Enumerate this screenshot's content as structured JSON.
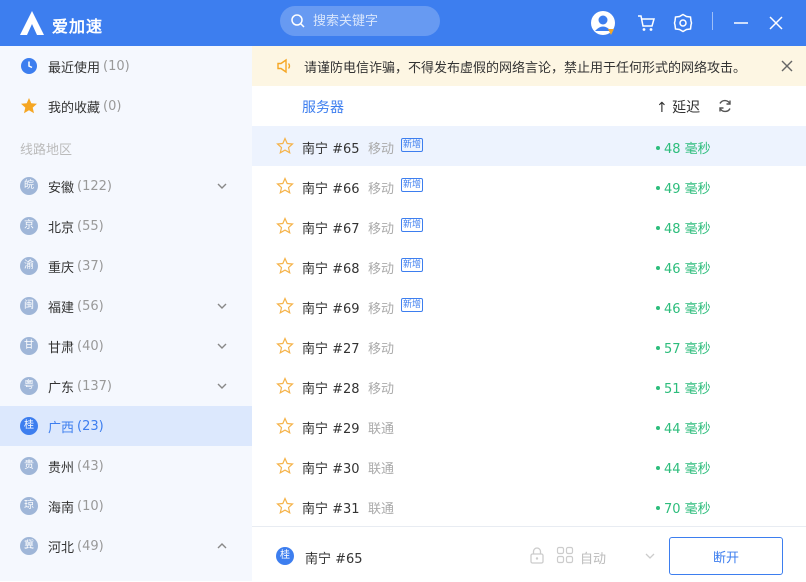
{
  "app": {
    "title": "爱加速",
    "search_placeholder": "搜索关键字"
  },
  "sidebar": {
    "top_items": [
      {
        "label": "最近使用",
        "count": "(10)"
      },
      {
        "label": "我的收藏",
        "count": "(0)"
      }
    ],
    "section_title": "线路地区",
    "regions": [
      {
        "badge": "皖",
        "label": "安徽",
        "count": "(122)"
      },
      {
        "badge": "京",
        "label": "北京",
        "count": "(55)"
      },
      {
        "badge": "渝",
        "label": "重庆",
        "count": "(37)"
      },
      {
        "badge": "闽",
        "label": "福建",
        "count": "(56)"
      },
      {
        "badge": "甘",
        "label": "甘肃",
        "count": "(40)"
      },
      {
        "badge": "粤",
        "label": "广东",
        "count": "(137)"
      },
      {
        "badge": "桂",
        "label": "广西",
        "count": "(23)"
      },
      {
        "badge": "贵",
        "label": "贵州",
        "count": "(43)"
      },
      {
        "badge": "琼",
        "label": "海南",
        "count": "(10)"
      },
      {
        "badge": "冀",
        "label": "河北",
        "count": "(49)"
      }
    ]
  },
  "notice": {
    "text": "请谨防电信诈骗，不得发布虚假的网络言论，禁止用于任何形式的网络攻击。"
  },
  "list": {
    "header_server": "服务器",
    "header_latency": "↑ 延迟",
    "rows": [
      {
        "name": "南宁 #65",
        "carrier": "移动",
        "tag": "新增",
        "latency": "48 毫秒"
      },
      {
        "name": "南宁 #66",
        "carrier": "移动",
        "tag": "新增",
        "latency": "49 毫秒"
      },
      {
        "name": "南宁 #67",
        "carrier": "移动",
        "tag": "新增",
        "latency": "48 毫秒"
      },
      {
        "name": "南宁 #68",
        "carrier": "移动",
        "tag": "新增",
        "latency": "46 毫秒"
      },
      {
        "name": "南宁 #69",
        "carrier": "移动",
        "tag": "新增",
        "latency": "46 毫秒"
      },
      {
        "name": "南宁 #27",
        "carrier": "移动",
        "tag": "",
        "latency": "57 毫秒"
      },
      {
        "name": "南宁 #28",
        "carrier": "移动",
        "tag": "",
        "latency": "51 毫秒"
      },
      {
        "name": "南宁 #29",
        "carrier": "联通",
        "tag": "",
        "latency": "44 毫秒"
      },
      {
        "name": "南宁 #30",
        "carrier": "联通",
        "tag": "",
        "latency": "44 毫秒"
      },
      {
        "name": "南宁 #31",
        "carrier": "联通",
        "tag": "",
        "latency": "70 毫秒"
      }
    ]
  },
  "bottom": {
    "badge": "桂",
    "server_name": "南宁 #65",
    "mode": "自动",
    "disconnect_label": "断开"
  },
  "colors": {
    "accent": "#3d7eef",
    "latency_good": "#2dbd7c",
    "notice_bg": "#fdf6e3"
  }
}
